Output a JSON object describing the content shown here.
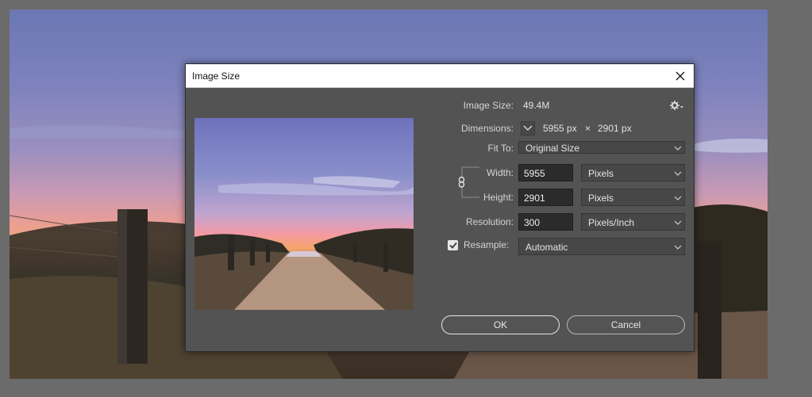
{
  "dialog": {
    "title": "Image Size",
    "image_size_label": "Image Size:",
    "image_size_value": "49.4M",
    "dimensions_label": "Dimensions:",
    "dimensions_width": "5955 px",
    "dimensions_separator": "×",
    "dimensions_height": "2901 px",
    "fit_to_label": "Fit To:",
    "fit_to_value": "Original Size",
    "width_label": "Width:",
    "width_value": "5955",
    "width_unit": "Pixels",
    "height_label": "Height:",
    "height_value": "2901",
    "height_unit": "Pixels",
    "resolution_label": "Resolution:",
    "resolution_value": "300",
    "resolution_unit": "Pixels/Inch",
    "resample_label": "Resample:",
    "resample_checked": true,
    "resample_value": "Automatic",
    "ok_label": "OK",
    "cancel_label": "Cancel"
  },
  "icons": {
    "close": "close-icon",
    "gear": "gear-icon",
    "dimensions_toggle": "chevron-down-icon",
    "constrain": "link-icon",
    "checkbox": "checkmark-icon",
    "dropdown": "chevron-down-icon"
  },
  "colors": {
    "dialog_bg": "#535353",
    "titlebar_bg": "#ffffff",
    "input_bg": "#2b2b2b",
    "select_bg": "#474747"
  }
}
